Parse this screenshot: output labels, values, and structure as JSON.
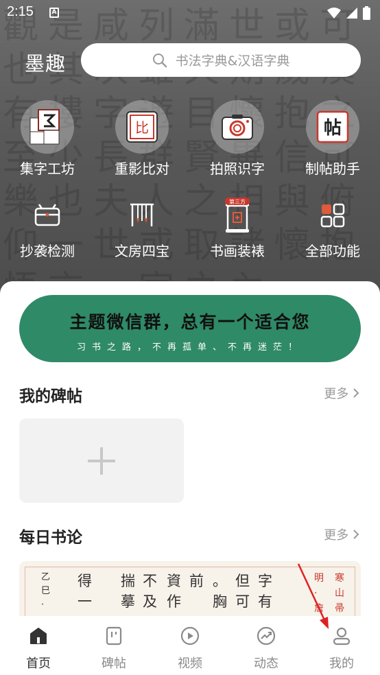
{
  "status_bar": {
    "time": "2:15",
    "notification_icon_letter": "A",
    "icons": [
      "wifi-icon",
      "signal-icon",
      "battery-icon"
    ]
  },
  "header": {
    "logo": "墨趣",
    "search_placeholder": "书法字典&汉语字典"
  },
  "features": [
    {
      "label": "集字工坊",
      "icon": "jizi-workshop-icon"
    },
    {
      "label": "重影比对",
      "icon": "overlay-compare-icon"
    },
    {
      "label": "拍照识字",
      "icon": "camera-icon"
    },
    {
      "label": "制帖助手",
      "icon": "tie-assistant-icon"
    },
    {
      "label": "抄袭检测",
      "icon": "plagiarism-check-icon"
    },
    {
      "label": "文房四宝",
      "icon": "stationery-icon"
    },
    {
      "label": "书画装裱",
      "icon": "mounting-icon"
    },
    {
      "label": "全部功能",
      "icon": "all-features-icon"
    }
  ],
  "badge_third_party": "第三方",
  "banner": {
    "line1": "主题微信群，总有一个适合您",
    "line2": "习书之路，不再孤单、不再迷茫！"
  },
  "my_copybooks": {
    "title": "我的碑帖",
    "more": "更多"
  },
  "daily_quote": {
    "title": "每日书论",
    "more": "更多",
    "columns": [
      "字",
      "但",
      "。",
      "前",
      "資",
      "不",
      "揣",
      "得"
    ],
    "columns2": [
      "有",
      "可",
      "胸",
      "",
      "作",
      "及",
      "摹",
      "一"
    ],
    "date_chars": [
      "乙",
      "巳",
      "·"
    ],
    "red_cols": [
      "明",
      "·",
      "詹"
    ],
    "red_cols2": [
      "寒",
      "山",
      "帚"
    ]
  },
  "tabs": [
    {
      "label": "首页",
      "icon": "home-icon",
      "active": true
    },
    {
      "label": "碑帖",
      "icon": "copybook-icon",
      "active": false
    },
    {
      "label": "视频",
      "icon": "video-icon",
      "active": false
    },
    {
      "label": "动态",
      "icon": "moments-icon",
      "active": false
    },
    {
      "label": "我的",
      "icon": "profile-icon",
      "active": false
    }
  ],
  "colors": {
    "banner_green": "#2f8a67",
    "annotation_arrow": "#e02020",
    "accent_red": "#c9372c"
  }
}
